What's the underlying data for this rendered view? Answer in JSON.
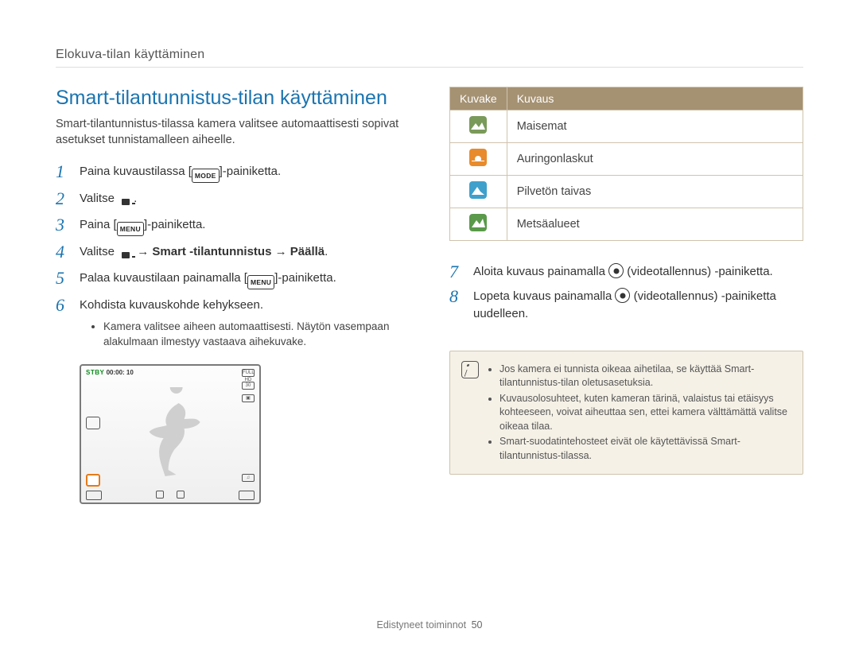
{
  "breadcrumb": "Elokuva-tilan käyttäminen",
  "section_title": "Smart-tilantunnistus-tilan käyttäminen",
  "intro": "Smart-tilantunnistus-tilassa kamera valitsee automaattisesti sopivat asetukset tunnistamalleen aiheelle.",
  "steps_left": [
    {
      "num": "1",
      "pre": "Paina kuvaustilassa [",
      "icon": "MODE",
      "post": "]-painiketta."
    },
    {
      "num": "2",
      "pre": "Valitse ",
      "icon": "camcorder",
      "post": "."
    },
    {
      "num": "3",
      "pre": "Paina [",
      "icon": "MENU",
      "post": "]-painiketta."
    },
    {
      "num": "4",
      "pre": "Valitse ",
      "icon": "camcorder",
      "post_bold": " → Smart -tilantunnistus → Päällä",
      "post": "."
    },
    {
      "num": "5",
      "pre": "Palaa kuvaustilaan painamalla [",
      "icon": "MENU",
      "post": "]-painiketta."
    },
    {
      "num": "6",
      "pre": "Kohdista kuvauskohde kehykseen.",
      "bullets": [
        "Kamera valitsee aiheen automaattisesti. Näytön vasempaan alakulmaan ilmestyy vastaava aihekuvake."
      ]
    }
  ],
  "camera_preview": {
    "stby": "STBY",
    "timecode": "00:00: 10"
  },
  "table": {
    "head_icon": "Kuvake",
    "head_desc": "Kuvaus",
    "rows": [
      {
        "color": "c1",
        "label": "Maisemat"
      },
      {
        "color": "c2",
        "label": "Auringonlaskut"
      },
      {
        "color": "c3",
        "label": "Pilvetön taivas"
      },
      {
        "color": "c4",
        "label": "Metsäalueet"
      }
    ]
  },
  "steps_right": [
    {
      "num": "7",
      "pre": "Aloita kuvaus painamalla ",
      "icon": "record",
      "post": " (videotallennus) -painiketta."
    },
    {
      "num": "8",
      "pre": "Lopeta kuvaus painamalla ",
      "icon": "record",
      "post": " (videotallennus) -painiketta uudelleen."
    }
  ],
  "notes": [
    "Jos kamera ei tunnista oikeaa aihetilaa, se käyttää Smart-tilantunnistus-tilan oletusasetuksia.",
    "Kuvausolosuhteet, kuten kameran tärinä, valaistus tai etäisyys kohteeseen, voivat aiheuttaa sen, ettei kamera välttämättä valitse oikeaa tilaa.",
    "Smart-suodatintehosteet eivät ole käytettävissä Smart-tilantunnistus-tilassa."
  ],
  "footer": {
    "label": "Edistyneet toiminnot",
    "page": "50"
  }
}
